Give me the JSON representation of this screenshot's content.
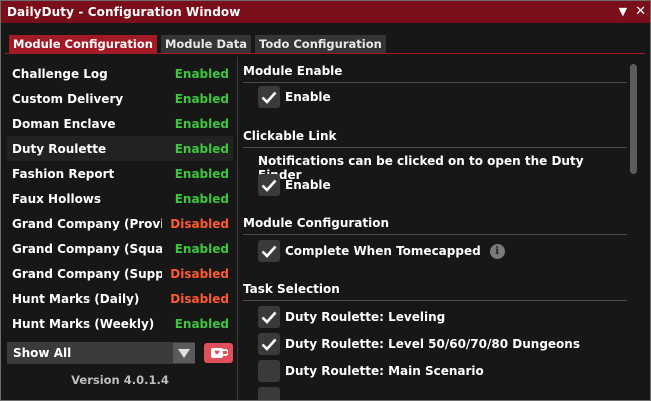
{
  "window": {
    "title": "DailyDuty - Configuration Window",
    "collapse_glyph": "▼",
    "close_glyph": "✕"
  },
  "tabs": [
    {
      "label": "Module Configuration",
      "active": true
    },
    {
      "label": "Module Data",
      "active": false
    },
    {
      "label": "Todo Configuration",
      "active": false
    }
  ],
  "modules": [
    {
      "name": "Challenge Log",
      "status": "Enabled",
      "enabled": true
    },
    {
      "name": "Custom Delivery",
      "status": "Enabled",
      "enabled": true
    },
    {
      "name": "Doman Enclave",
      "status": "Enabled",
      "enabled": true
    },
    {
      "name": "Duty Roulette",
      "status": "Enabled",
      "enabled": true,
      "selected": true
    },
    {
      "name": "Fashion Report",
      "status": "Enabled",
      "enabled": true
    },
    {
      "name": "Faux Hollows",
      "status": "Enabled",
      "enabled": true
    },
    {
      "name": "Grand Company (Provisioning)",
      "status": "Disabled",
      "enabled": false
    },
    {
      "name": "Grand Company (Squadron)",
      "status": "Enabled",
      "enabled": true
    },
    {
      "name": "Grand Company (Supply)",
      "status": "Disabled",
      "enabled": false
    },
    {
      "name": "Hunt Marks (Daily)",
      "status": "Disabled",
      "enabled": false
    },
    {
      "name": "Hunt Marks (Weekly)",
      "status": "Enabled",
      "enabled": true
    }
  ],
  "filter": {
    "value": "Show All"
  },
  "version": "Version 4.0.1.4",
  "config": {
    "module_enable": {
      "header": "Module Enable",
      "enable_label": "Enable",
      "checked": true
    },
    "clickable_link": {
      "header": "Clickable Link",
      "description": "Notifications can be clicked on to open the Duty Finder",
      "enable_label": "Enable",
      "checked": true
    },
    "module_configuration": {
      "header": "Module Configuration",
      "complete_label": "Complete When Tomecapped",
      "checked": true,
      "info_glyph": "i"
    },
    "task_selection": {
      "header": "Task Selection",
      "tasks": [
        {
          "label": "Duty Roulette: Leveling",
          "checked": true
        },
        {
          "label": "Duty Roulette: Level 50/60/70/80 Dungeons",
          "checked": true
        },
        {
          "label": "Duty Roulette: Main Scenario",
          "checked": false
        }
      ]
    }
  },
  "colors": {
    "title_bar": "#7a0e1b",
    "accent": "#a31a27",
    "enabled": "#3cc83c",
    "disabled": "#ff5a2a",
    "kofi": "#e0505a"
  }
}
